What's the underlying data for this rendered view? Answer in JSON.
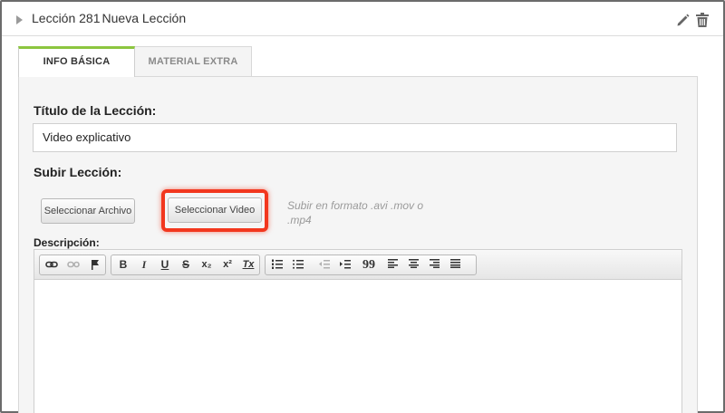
{
  "header": {
    "lesson_number": "Lección 281",
    "lesson_name": "Nueva Lección"
  },
  "tabs": [
    {
      "label": "INFO BÁSICA",
      "active": true
    },
    {
      "label": "MATERIAL EXTRA",
      "active": false
    }
  ],
  "form": {
    "title_label": "Título de la Lección:",
    "title_value": "Video explicativo",
    "upload_label": "Subir Lección:",
    "select_file_label": "Seleccionar Archivo",
    "select_video_label": "Seleccionar Video",
    "upload_hint": "Subir en formato .avi .mov o .mp4",
    "description_label": "Descripción:"
  },
  "toolbar": {
    "bold": "B",
    "italic": "I",
    "underline": "U",
    "strike": "S",
    "subscript": "x₂",
    "superscript": "x²",
    "clear_format": "Tx",
    "quote": "99"
  },
  "colors": {
    "accent": "#8cc63f",
    "highlight": "#f2371e"
  }
}
